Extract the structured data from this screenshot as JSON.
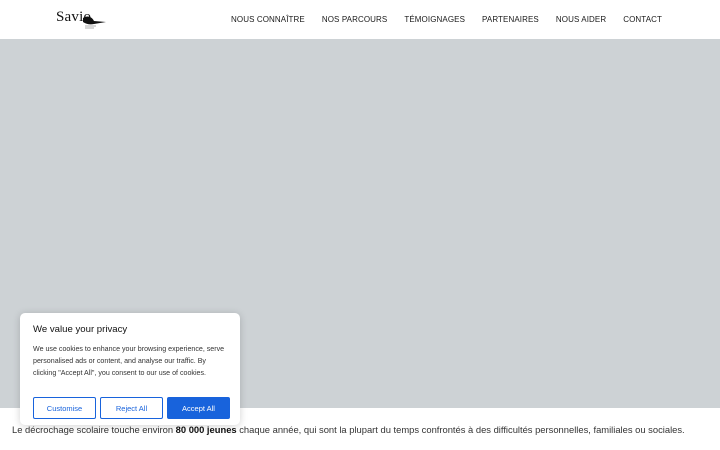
{
  "header": {
    "logo_text": "Savio",
    "nav": [
      {
        "label": "NOUS CONNAÎTRE"
      },
      {
        "label": "NOS PARCOURS"
      },
      {
        "label": "TÉMOIGNAGES"
      },
      {
        "label": "PARTENAIRES"
      },
      {
        "label": "NOUS AIDER"
      },
      {
        "label": "CONTACT"
      }
    ]
  },
  "main": {
    "intro_before": "Le décrochage scolaire touche environ ",
    "intro_bold": "80 000 jeunes",
    "intro_after": " chaque année, qui sont la plupart du temps confrontés à des difficultés personnelles, familiales ou sociales."
  },
  "cookie_banner": {
    "title": "We value your privacy",
    "description": "We use cookies to enhance your browsing experience, serve personalised ads or content, and analyse our traffic. By clicking \"Accept All\", you consent to our use of cookies.",
    "customise_label": "Customise",
    "reject_label": "Reject All",
    "accept_label": "Accept All"
  },
  "colors": {
    "accent": "#1863dc",
    "hero_placeholder": "#cdd2d5"
  }
}
